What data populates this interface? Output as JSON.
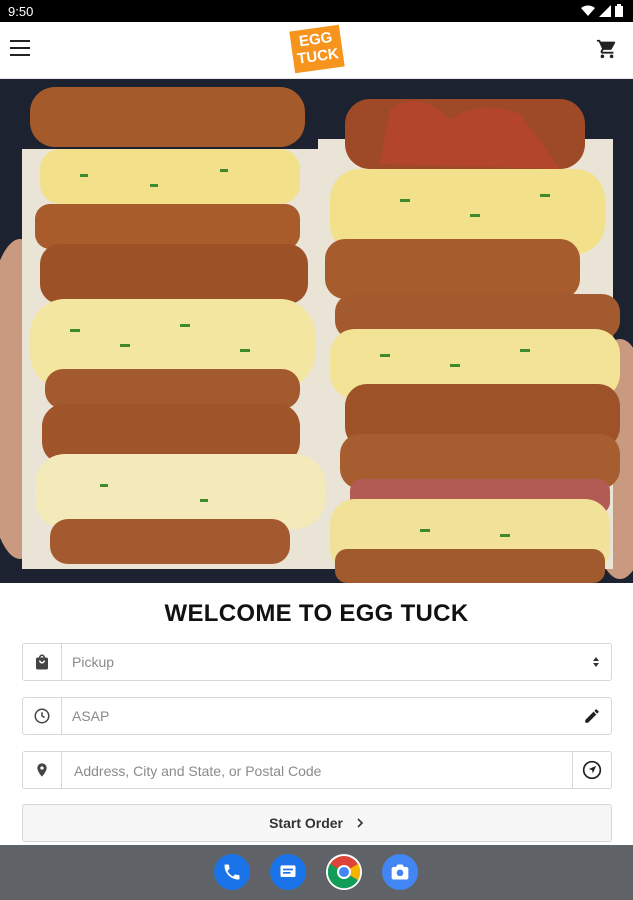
{
  "status_bar": {
    "time": "9:50"
  },
  "header": {
    "logo_line1": "EGG",
    "logo_line2": "TUCK"
  },
  "main": {
    "welcome_title": "WELCOME TO EGG TUCK",
    "order_type": {
      "value": "Pickup"
    },
    "order_time": {
      "value": "ASAP"
    },
    "address": {
      "placeholder": "Address, City and State, or Postal Code"
    },
    "start_order_label": "Start Order"
  },
  "dock": {
    "apps": [
      "phone-icon",
      "messages-icon",
      "chrome-icon",
      "camera-icon"
    ]
  },
  "colors": {
    "brand": "#f7941d",
    "nav_bar": "#5f6368",
    "phone": "#1a73e8",
    "messages": "#1a73e8"
  }
}
